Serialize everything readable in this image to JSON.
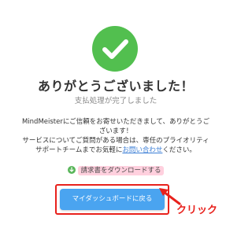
{
  "confirmation": {
    "title": "ありがとうございました！",
    "subtitle": "支払処理が完了しました",
    "message_line1": "MindMeisterにご信頼をお寄せいただきまして、ありがとうご",
    "message_line2": "ざいます！",
    "message_line3": "サービスについてご質問がある場合は、専任のプライオリティ",
    "message_line4_prefix": "サポートチームまでお気軽に",
    "inquiry_link": "お問い合わせ",
    "message_line4_suffix": "ください。",
    "download_link": "請求書をダウンロードする",
    "dashboard_button": "マイダッシュボードに戻る"
  },
  "annotation": {
    "click_label": "クリック"
  },
  "icons": {
    "success": "checkmark-circle-icon",
    "download": "download-icon",
    "arrow": "red-arrow-icon"
  },
  "colors": {
    "success_green": "#52bf4f",
    "button_blue": "#4aa4f0",
    "annotation_red": "#e8211c",
    "link_blue": "#3d7fd6"
  }
}
